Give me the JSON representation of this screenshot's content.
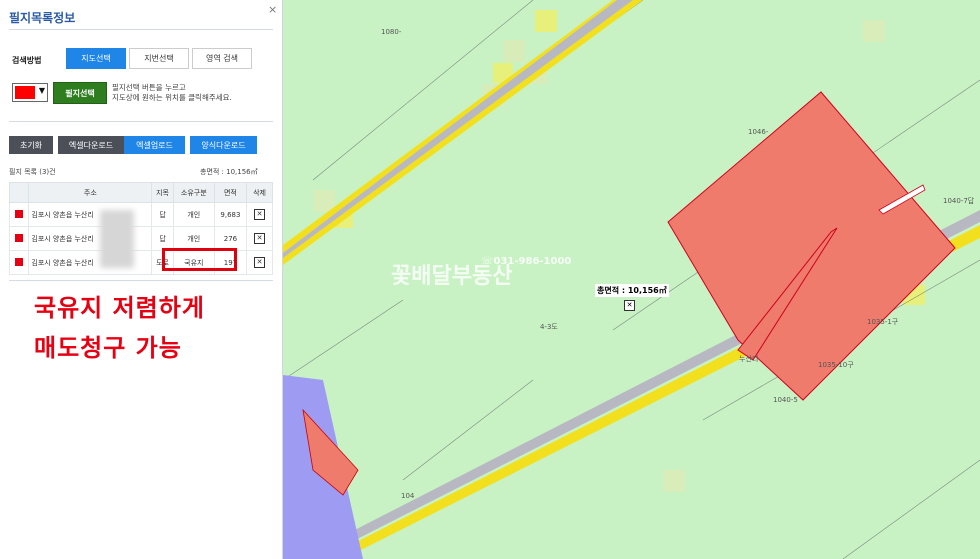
{
  "panel": {
    "title": "필지목록정보",
    "close": "×",
    "search_method_label": "검색방법",
    "tabs": [
      {
        "label": "지도선택",
        "active": true
      },
      {
        "label": "지번선택",
        "active": false
      },
      {
        "label": "영역 검색",
        "active": false
      }
    ],
    "color_swatch": "#ff0000",
    "select_button": "필지선택",
    "help_line1": "필지선택 버튼을 누르고",
    "help_line2": "지도상에 원하는 위치를 클릭해주세요.",
    "actions": [
      "초기화",
      "엑셀다운로드",
      "엑셀업로드",
      "양식다운로드"
    ],
    "list_count": "필지 목록 (3)건",
    "total_area": "총면적 : 10,156㎡",
    "columns": [
      "",
      "주소",
      "지목",
      "소유구분",
      "면적",
      "삭제"
    ],
    "rows": [
      {
        "address": "김포시 양촌읍 누산리",
        "jimok": "답",
        "owner": "개인",
        "area": "9,683"
      },
      {
        "address": "김포시 양촌읍 누산리",
        "jimok": "답",
        "owner": "개인",
        "area": "276"
      },
      {
        "address": "김포시 양촌읍 누산리",
        "jimok": "도로",
        "owner": "국유지",
        "area": "197"
      }
    ],
    "annotation_line1": "국유지 저렴하게",
    "annotation_line2": "매도청구 가능"
  },
  "map": {
    "watermark": "꽃배달부동산",
    "phone": "☏031-986-1000",
    "total_area": "총면적 : 10,156㎡",
    "labels": [
      "1080-",
      "1046-",
      "1040-7답",
      "4-3도",
      "1035-1구",
      "1035-10구",
      "누산리",
      "1040-5",
      "104"
    ]
  },
  "colors": {
    "accent": "#1f86e8",
    "select_green": "#2e7d1f",
    "highlight": "#e0000d",
    "parcel": "#ee7b6c",
    "map_bg": "#c9f2c4"
  }
}
